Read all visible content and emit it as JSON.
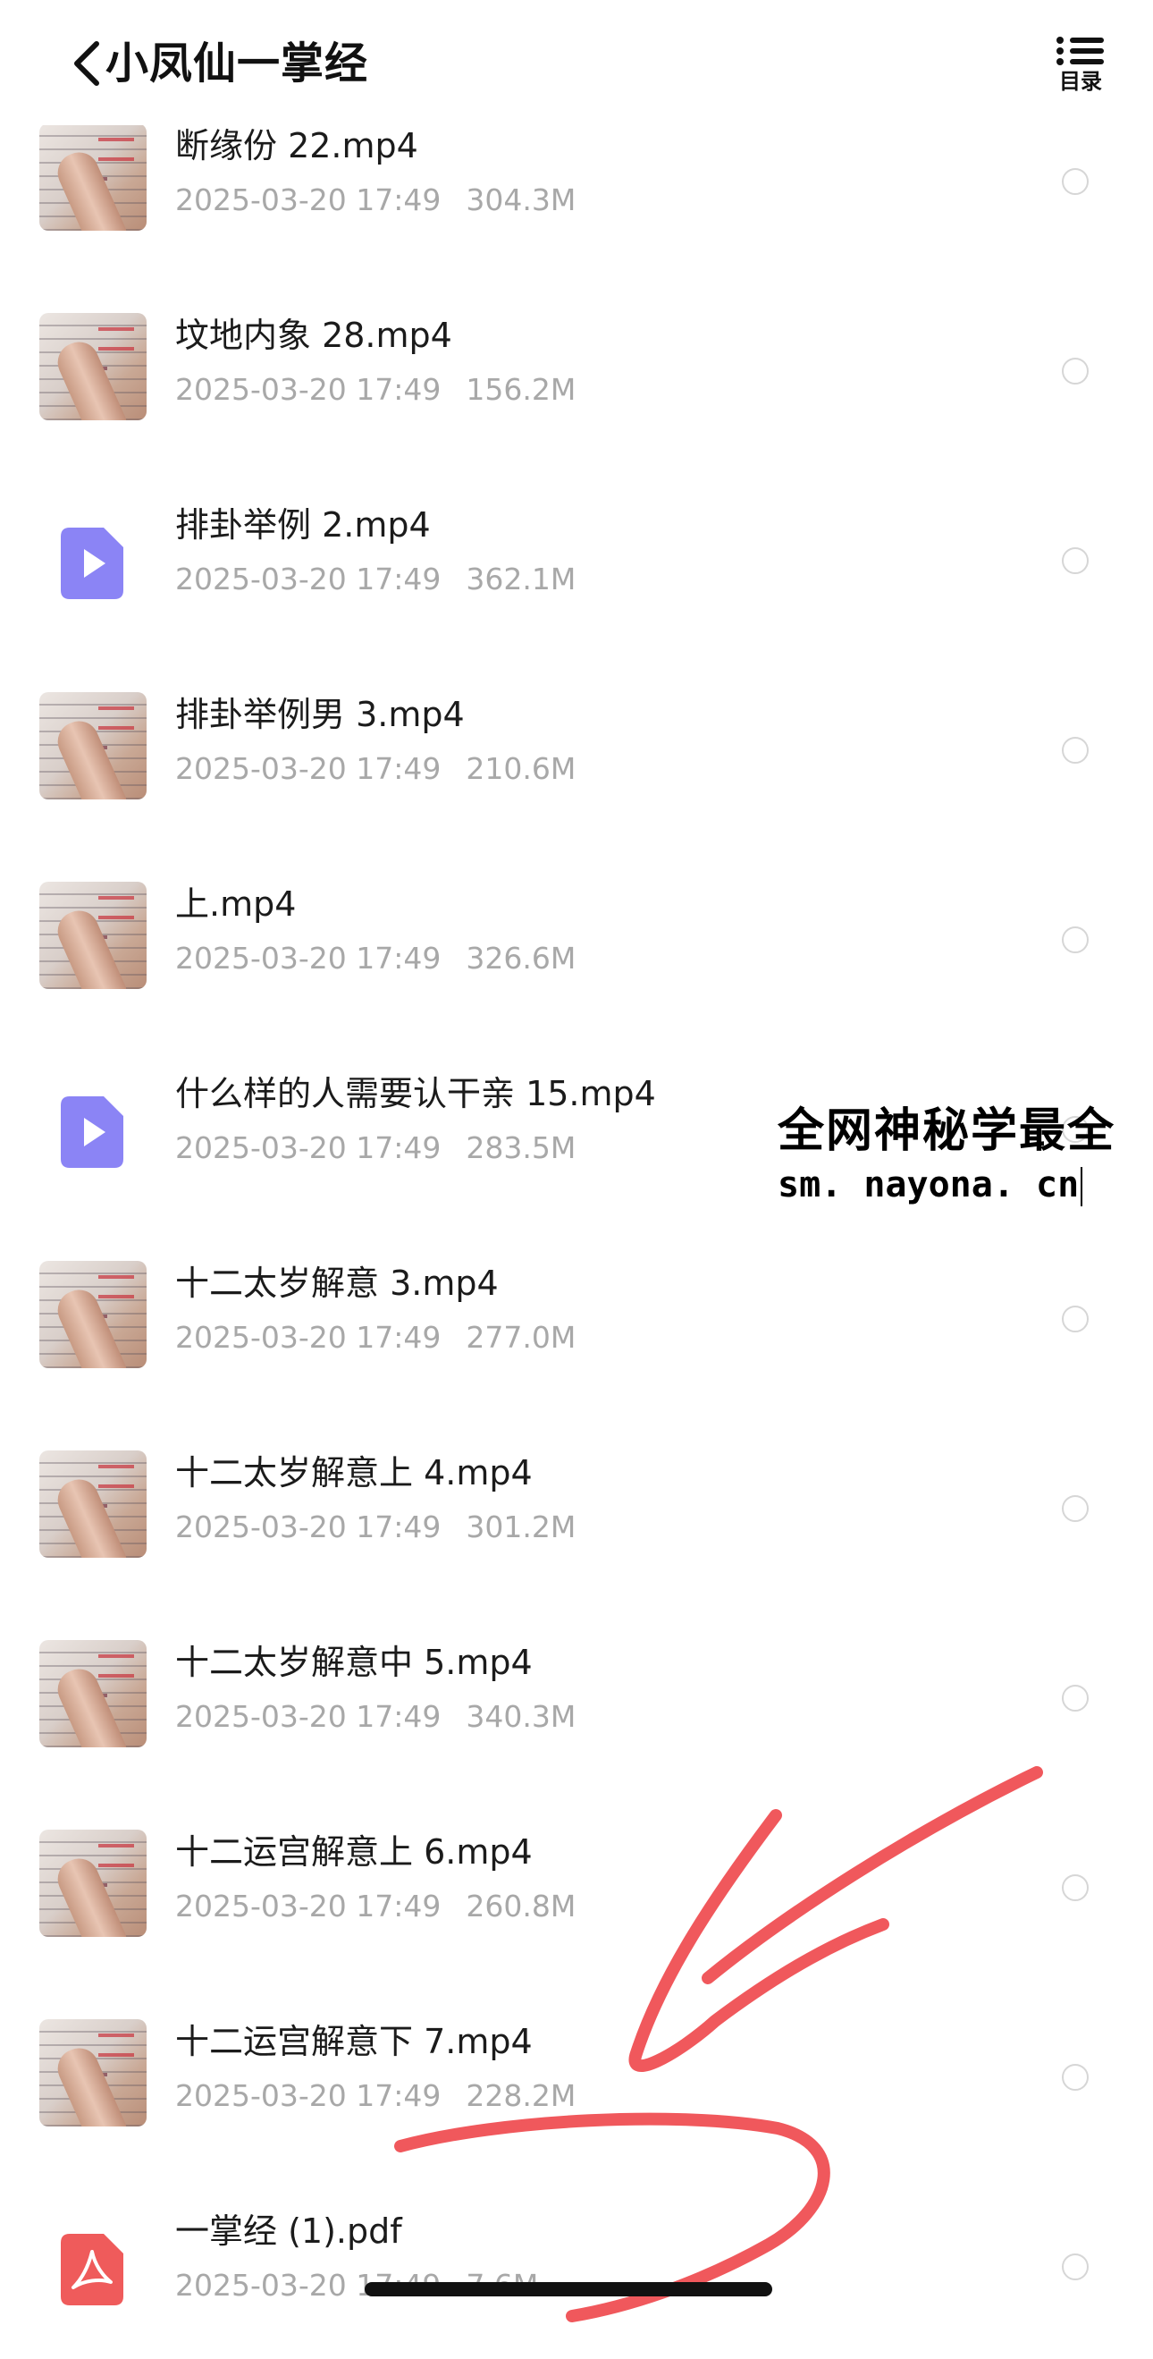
{
  "header": {
    "back_icon": "chevron-left-icon",
    "title": "小凤仙一掌经",
    "toc_icon": "list-icon",
    "toc_label": "目录"
  },
  "files": [
    {
      "name": "断缘份 22.mp4",
      "date": "2025-03-20 17:49",
      "size": "304.3M",
      "type": "video-thumbnail"
    },
    {
      "name": "坟地内象 28.mp4",
      "date": "2025-03-20 17:49",
      "size": "156.2M",
      "type": "video-thumbnail"
    },
    {
      "name": "排卦举例 2.mp4",
      "date": "2025-03-20 17:49",
      "size": "362.1M",
      "type": "video-icon"
    },
    {
      "name": "排卦举例男 3.mp4",
      "date": "2025-03-20 17:49",
      "size": "210.6M",
      "type": "video-thumbnail"
    },
    {
      "name": "上.mp4",
      "date": "2025-03-20 17:49",
      "size": "326.6M",
      "type": "video-thumbnail"
    },
    {
      "name": "什么样的人需要认干亲 15.mp4",
      "date": "2025-03-20 17:49",
      "size": "283.5M",
      "type": "video-icon"
    },
    {
      "name": "十二太岁解意 3.mp4",
      "date": "2025-03-20 17:49",
      "size": "277.0M",
      "type": "video-thumbnail"
    },
    {
      "name": "十二太岁解意上 4.mp4",
      "date": "2025-03-20 17:49",
      "size": "301.2M",
      "type": "video-thumbnail"
    },
    {
      "name": "十二太岁解意中 5.mp4",
      "date": "2025-03-20 17:49",
      "size": "340.3M",
      "type": "video-thumbnail"
    },
    {
      "name": "十二运宫解意上 6.mp4",
      "date": "2025-03-20 17:49",
      "size": "260.8M",
      "type": "video-thumbnail"
    },
    {
      "name": "十二运宫解意下 7.mp4",
      "date": "2025-03-20 17:49",
      "size": "228.2M",
      "type": "video-thumbnail"
    },
    {
      "name": "一掌经 (1).pdf",
      "date": "2025-03-20 17:49",
      "size": "7.6M",
      "type": "pdf-icon"
    }
  ],
  "watermark": {
    "line1": "全网神秘学最全",
    "line2": "sm. nayona. cn"
  },
  "colors": {
    "video_icon": "#8b84f5",
    "pdf_icon": "#ef5b5b",
    "annotation_stroke": "#f0585c",
    "meta_text": "#a8a8a8"
  }
}
